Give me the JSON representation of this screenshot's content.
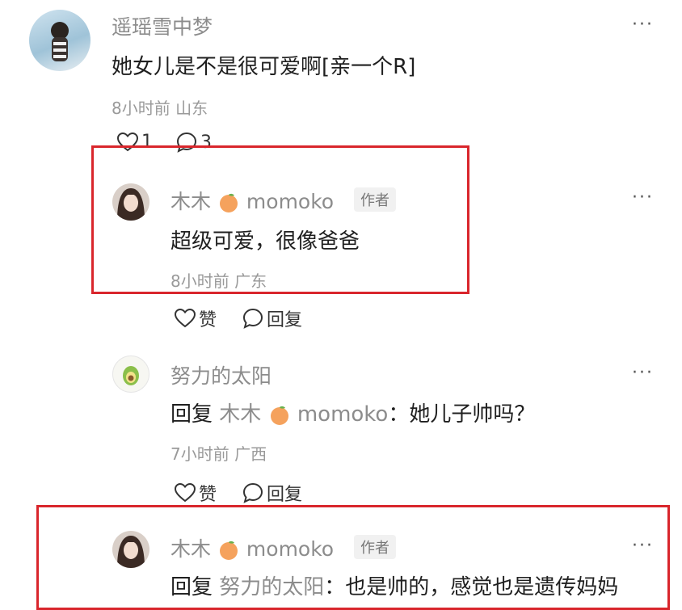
{
  "comments": [
    {
      "username": "遥瑶雪中梦",
      "text": "她女儿是不是很可爱啊[亲一个R]",
      "time": "8小时前",
      "location": "山东",
      "like_count": "1",
      "reply_count": "3"
    },
    {
      "username": "木木",
      "username_suffix": "momoko",
      "badge": "作者",
      "text": "超级可爱，很像爸爸",
      "time": "8小时前",
      "location": "广东",
      "like_label": "赞",
      "reply_label": "回复"
    },
    {
      "username": "努力的太阳",
      "reply_prefix": "回复",
      "reply_target": "木木",
      "reply_target_suffix": "momoko",
      "text": "：她儿子帅吗？",
      "time": "7小时前",
      "location": "广西",
      "like_label": "赞",
      "reply_label": "回复"
    },
    {
      "username": "木木",
      "username_suffix": "momoko",
      "badge": "作者",
      "reply_prefix": "回复",
      "reply_target": "努力的太阳",
      "text": "：也是帅的，感觉也是遗传妈妈"
    }
  ],
  "more_label": "···",
  "colors": {
    "highlight_border": "#d9262c",
    "meta_text": "#9a9a9a",
    "peach": "#f5a25d"
  }
}
